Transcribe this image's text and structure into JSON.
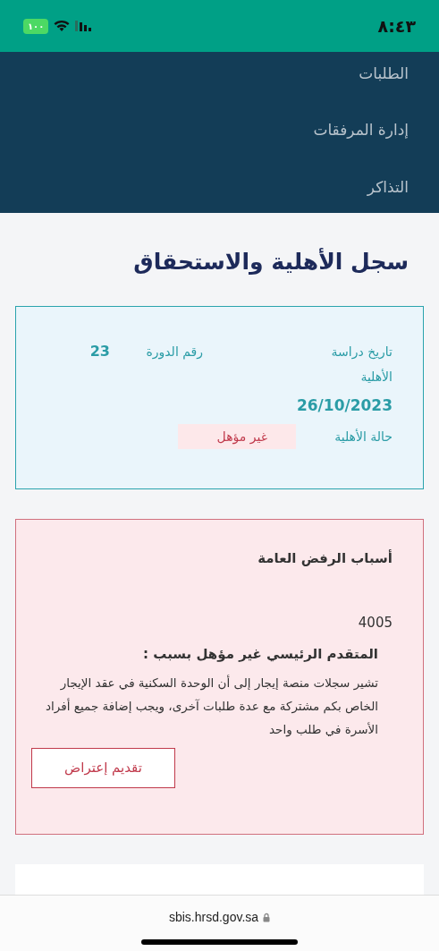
{
  "status_bar": {
    "time": "٨:٤٣",
    "battery": "١٠٠"
  },
  "nav": {
    "items": [
      {
        "label": "الطلبات"
      },
      {
        "label": "إدارة المرفقات"
      },
      {
        "label": "التذاكر"
      }
    ]
  },
  "page_title": "سجل الأهلية والاستحقاق",
  "eligibility_card": {
    "study_date_label": "تاريخ دراسة الأهلية",
    "cycle_label": "رقم الدورة",
    "cycle_value": "23",
    "study_date_value": "26/10/2023",
    "status_label": "حالة الأهلية",
    "status_value": "غير مؤهل"
  },
  "rejection_card": {
    "title": "أسباب الرفض العامة",
    "code": "4005",
    "reason_heading": "المتقدم الرئيسي غير مؤهل بسبب :",
    "reason_text": "تشير سجلات منصة إيجار إلى أن الوحدة السكنية في عقد الإيجار الخاص بكم مشتركة مع عدة طلبات آخرى، ويجب إضافة جميع أفراد الأسرة في طلب واحد",
    "objection_button": "تقديم إعتراض"
  },
  "browser_bar": {
    "url": "sbis.hrsd.gov.sa"
  }
}
